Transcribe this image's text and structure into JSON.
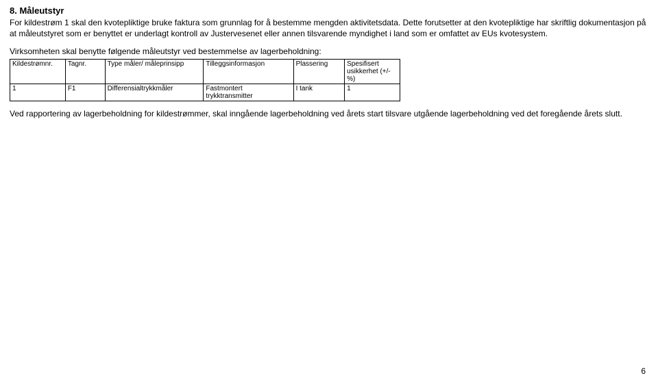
{
  "heading": "8. Måleutstyr",
  "para1": "For kildestrøm 1 skal den kvotepliktige bruke faktura som grunnlag for å bestemme mengden aktivitetsdata. Dette forutsetter at den kvotepliktige har skriftlig dokumentasjon på at måleutstyret som er benyttet er underlagt kontroll av Justervesenet eller annen tilsvarende myndighet i land som er omfattet av EUs kvotesystem.",
  "para2": "Virksomheten skal benytte følgende måleutstyr ved bestemmelse av lagerbeholdning:",
  "table": {
    "headers": {
      "col1": "Kildestrømnr.",
      "col2": "Tagnr.",
      "col3": "Type måler/ måleprinsipp",
      "col4": "Tilleggsinformasjon",
      "col5": "Plassering",
      "col6": "Spesifisert usikkerhet (+/- %)"
    },
    "rows": [
      {
        "col1": "1",
        "col2": "F1",
        "col3": "Differensialtrykkmåler",
        "col4": "Fastmontert trykktransmitter",
        "col5": "I tank",
        "col6": "1"
      }
    ]
  },
  "para3": "Ved rapportering av lagerbeholdning for kildestrømmer, skal inngående lagerbeholdning ved årets start tilsvare utgående lagerbeholdning ved det foregående årets slutt.",
  "pageNumber": "6"
}
